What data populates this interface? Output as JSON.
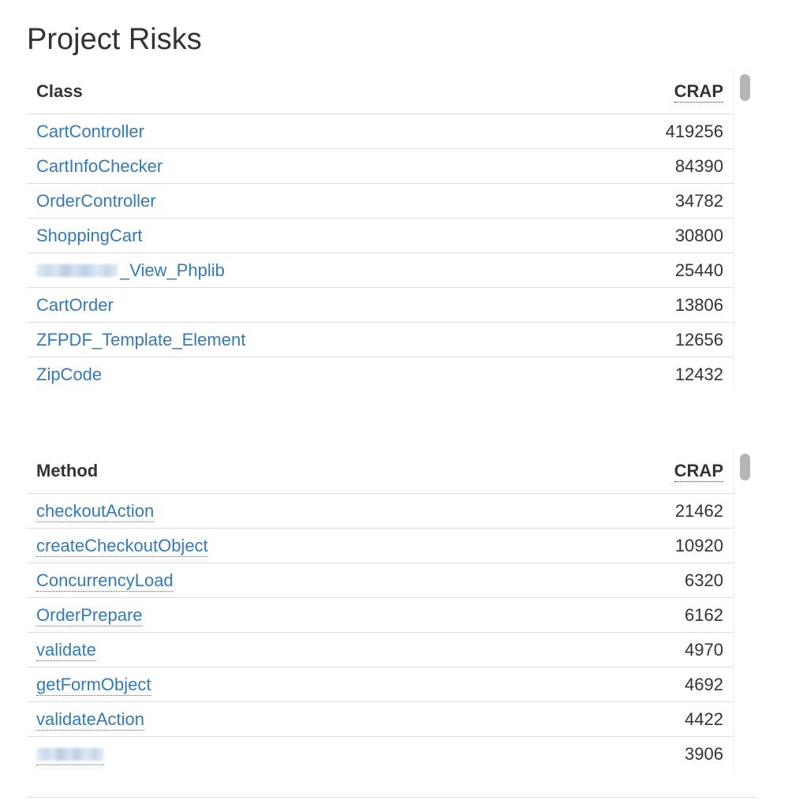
{
  "page": {
    "title": "Project Risks"
  },
  "classes": {
    "header_name": "Class",
    "header_crap": "CRAP",
    "rows": [
      {
        "name": "CartController",
        "crap": "419256"
      },
      {
        "name": "CartInfoChecker",
        "crap": "84390"
      },
      {
        "name": "OrderController",
        "crap": "34782"
      },
      {
        "name": "ShoppingCart",
        "crap": "30800"
      },
      {
        "name": "_View_Phplib",
        "crap": "25440",
        "redacted_prefix": true
      },
      {
        "name": "CartOrder",
        "crap": "13806"
      },
      {
        "name": "ZFPDF_Template_Element",
        "crap": "12656"
      },
      {
        "name": "ZipCode",
        "crap": "12432"
      }
    ]
  },
  "methods": {
    "header_name": "Method",
    "header_crap": "CRAP",
    "rows": [
      {
        "name": "checkoutAction",
        "crap": "21462"
      },
      {
        "name": "createCheckoutObject",
        "crap": "10920"
      },
      {
        "name": "ConcurrencyLoad",
        "crap": "6320"
      },
      {
        "name": "OrderPrepare",
        "crap": "6162"
      },
      {
        "name": "validate",
        "crap": "4970"
      },
      {
        "name": "getFormObject",
        "crap": "4692"
      },
      {
        "name": "validateAction",
        "crap": "4422"
      },
      {
        "name": "",
        "crap": "3906",
        "redacted": true
      }
    ]
  },
  "colors": {
    "link": "#337ab7",
    "text": "#333333",
    "border": "#dddddd",
    "scroll_thumb": "#b5b5b5"
  }
}
